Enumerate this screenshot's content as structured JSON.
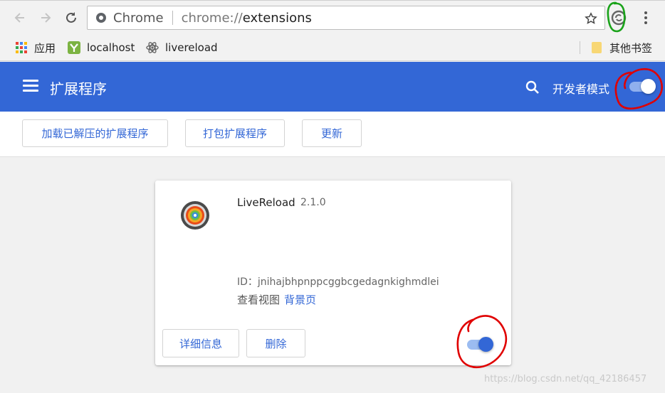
{
  "browser": {
    "omnibox_label": "Chrome",
    "url_scheme": "chrome://",
    "url_host": "extensions"
  },
  "bookmarks": {
    "apps": "应用",
    "localhost": "localhost",
    "livereload": "livereload",
    "other": "其他书签"
  },
  "header": {
    "title": "扩展程序",
    "dev_mode_label": "开发者模式",
    "dev_mode_on": true
  },
  "actions": {
    "load_unpacked": "加载已解压的扩展程序",
    "pack": "打包扩展程序",
    "update": "更新"
  },
  "extension": {
    "name": "LiveReload",
    "version": "2.1.0",
    "id_text": "ID：jnihajbhpnppcggbcgedagnkighmdlei",
    "inspect_label": "查看视图",
    "background_link": "背景页",
    "details_label": "详细信息",
    "remove_label": "删除",
    "enabled": true
  },
  "watermark": "https://blog.csdn.net/qq_42186457",
  "colors": {
    "header_blue": "#3367d6",
    "link_blue": "#3367d6",
    "annotation_red": "#e00000",
    "annotation_green": "#1aa31a"
  }
}
